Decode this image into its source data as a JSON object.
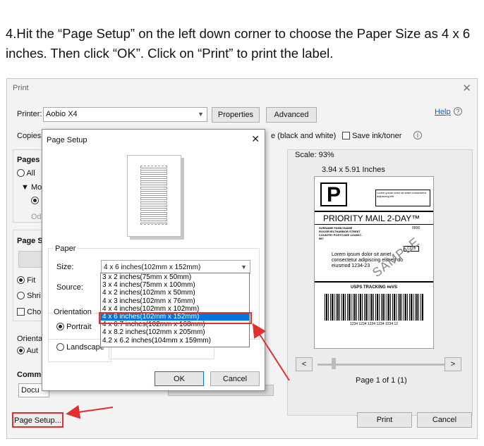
{
  "instruction": "4.Hit the “Page Setup” on the left down corner to choose the Paper Size as 4 x 6 inches. Then click “OK”. Click on “Print” to print the label.",
  "print_window": {
    "title": "Print",
    "printer_label": "Printer:",
    "printer_value": "Aobio X4",
    "properties": "Properties",
    "advanced": "Advanced",
    "help": "Help",
    "copies_label": "Copies",
    "bw_text": "e (black and white)",
    "save_ink": "Save ink/toner",
    "pages_label": "Pages",
    "all_label": "All",
    "more_label": "Mo",
    "od_label": "Od",
    "page_sizing": "Page S",
    "fit": "Fit",
    "shrink": "Shri",
    "choose": "Cho",
    "orientation": "Orienta",
    "auto": "Aut",
    "comments": "Comm",
    "document": "Docu",
    "scale": "Scale:  93%",
    "dims": "3.94 x 5.91 Inches",
    "page_of": "Page 1 of 1 (1)",
    "page_setup": "Page Setup...",
    "print": "Print",
    "cancel": "Cancel",
    "nav_prev": "<",
    "nav_next": ">"
  },
  "label_preview": {
    "p_letter": "P",
    "lorem_box": "Lorem ipsum dolor sit amet consectetur adipiscing elit",
    "priority": "PRIORITY MAIL 2-DAY™",
    "address": "SURNAME FAMILYNAME ROOSEVELTHARBOR STREET COUNTRY POSTCODE 1234567-987",
    "code1": "0006",
    "code2": "C019",
    "body": "Lorem ipsum dolor sit amet consectetur adipiscing elitsed do eiusmod  1234-23",
    "sample": "SAMPLE",
    "tracking": "USPS TRACKING #eVS",
    "tracking_number": "1234 1234 1234 1234 1234 12"
  },
  "page_setup_dialog": {
    "title": "Page Setup",
    "paper_label": "Paper",
    "size_label": "Size:",
    "size_value": "4 x 6 inches(102mm x 152mm)",
    "source_label": "Source:",
    "orientation_label": "Orientation",
    "portrait": "Portrait",
    "landscape": "Landscape",
    "ok": "OK",
    "cancel": "Cancel",
    "close": "✕",
    "options": [
      "3 x 2 inches(75mm x 50mm)",
      "3 x 4 inches(75mm x 100mm)",
      "4 x 2 inches(102mm x 50mm)",
      "4 x 3 inches(102mm x 76mm)",
      "4 x 4 inches(102mm x 102mm)",
      "4 x 6 inches(102mm x 152mm)",
      "4 x 6.7 inches(102mm x 168mm)",
      "4 x 8.2 inches(102mm x 205mm)",
      "4.2 x 6.2 inches(104mm x 159mm)"
    ],
    "selected_index": 5
  },
  "colors": {
    "accent": "#0078d7",
    "highlight": "#e03030",
    "link": "#1a5fb4"
  }
}
